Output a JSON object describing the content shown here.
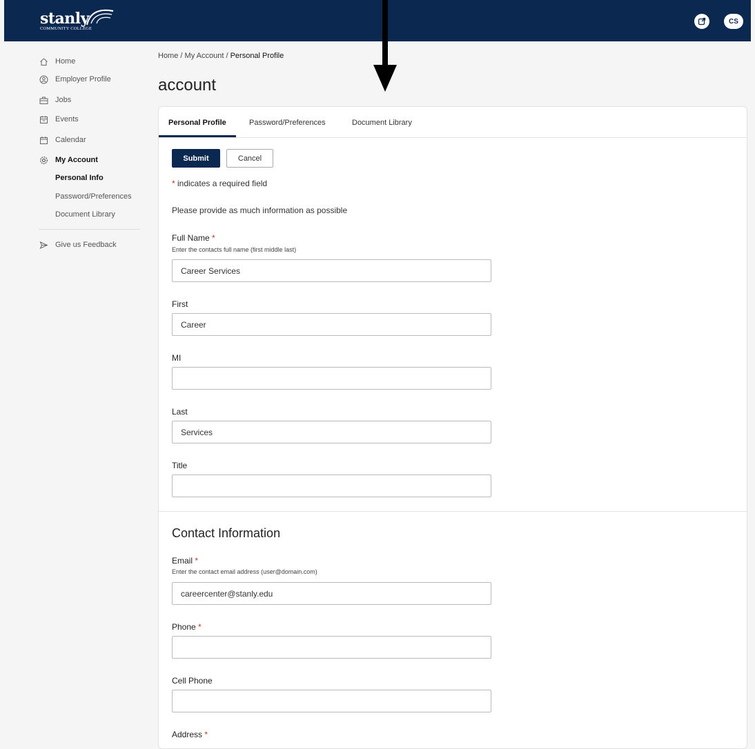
{
  "header": {
    "logo_text": "stanly",
    "logo_subtext": "COMMUNITY COLLEGE",
    "external_link_icon": "external-link-icon",
    "avatar_initials": "CS",
    "colors": {
      "topbar": "#0b2850",
      "accent": "#0b2850",
      "required": "#c0392b"
    }
  },
  "sidebar": {
    "items": [
      {
        "label": "Home",
        "icon": "home-icon"
      },
      {
        "label": "Employer Profile",
        "icon": "employer-profile-icon"
      },
      {
        "label": "Jobs",
        "icon": "briefcase-icon"
      },
      {
        "label": "Events",
        "icon": "events-icon"
      },
      {
        "label": "Calendar",
        "icon": "calendar-icon"
      },
      {
        "label": "My Account",
        "icon": "gear-icon"
      }
    ],
    "subitems": [
      {
        "label": "Personal Info"
      },
      {
        "label": "Password/Preferences"
      },
      {
        "label": "Document Library"
      }
    ],
    "feedback": {
      "label": "Give us Feedback",
      "icon": "send-icon"
    }
  },
  "breadcrumb": {
    "home": "Home",
    "sep1": "/",
    "my_account": "My Account",
    "sep2": "/",
    "current": "Personal Profile"
  },
  "page": {
    "title": "account"
  },
  "tabs": [
    {
      "label": "Personal Profile"
    },
    {
      "label": "Password/Preferences"
    },
    {
      "label": "Document Library"
    }
  ],
  "form": {
    "submit_label": "Submit",
    "cancel_label": "Cancel",
    "required_star": "*",
    "required_note": " indicates a required field",
    "info_note": "Please provide as much information as possible",
    "full_name": {
      "label": "Full Name",
      "help": "Enter the contacts full name (first middle last)",
      "value": "Career Services"
    },
    "first": {
      "label": "First",
      "value": "Career"
    },
    "mi": {
      "label": "MI",
      "value": ""
    },
    "last": {
      "label": "Last",
      "value": "Services"
    },
    "title": {
      "label": "Title",
      "value": ""
    }
  },
  "contact": {
    "section_title": "Contact Information",
    "email": {
      "label": "Email",
      "help": "Enter the contact email address (user@domain.com)",
      "value": "careercenter@stanly.edu"
    },
    "phone": {
      "label": "Phone",
      "value": ""
    },
    "cell_phone": {
      "label": "Cell Phone",
      "value": ""
    },
    "address": {
      "label": "Address"
    }
  },
  "annotation": {
    "icon": "down-arrow-icon"
  }
}
